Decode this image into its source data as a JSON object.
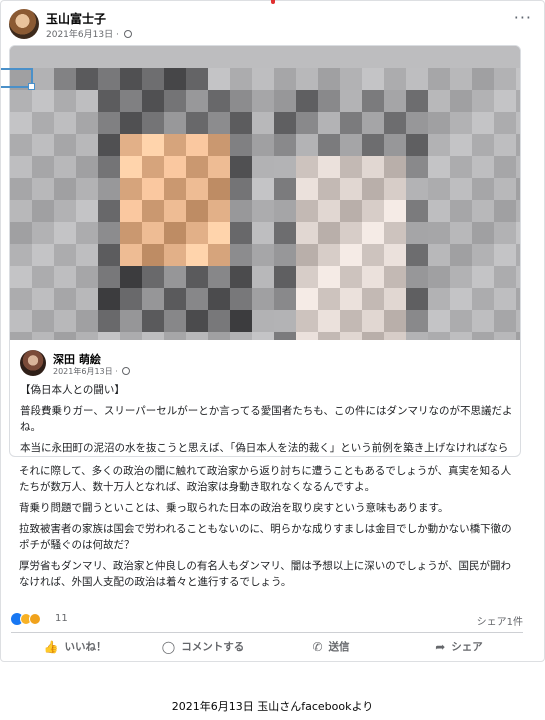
{
  "post": {
    "author": "玉山富士子",
    "date": "2021年6月13日",
    "separator": "·",
    "more_icon": "more-horizontal-icon",
    "privacy_icon": "globe-icon"
  },
  "shared_post": {
    "author": "深田 萌絵",
    "date": "2021年6月13日",
    "separator": "·",
    "privacy_icon": "globe-icon",
    "paragraphs": [
      "【偽日本人との闘い】",
      "普段費乗りガー、スリーパーセルがーとか言ってる愛国者たちも、この件にはダンマリなのが不思議だよね。",
      "本当に永田町の泥沼の水を抜こうと思えば、「偽日本人を法的裁く」という前例を築き上げなければならない。"
    ]
  },
  "post_text": {
    "paragraphs": [
      "それに際して、多くの政治の闇に触れて政治家から返り討ちに遭うこともあるでしょうが、真実を知る人たちが数万人、数十万人となれば、政治家は身動き取れなくなるんですよ。",
      "背乗り問題で闘うといことは、乗っ取られた日本の政治を取り戻すという意味もあります。",
      "拉致被害者の家族は国会で労われることもないのに、明らかな成りすましは金目でしか動かない橋下徹のポチが騒ぐのは何故だ？",
      "厚労省もダンマリ、政治家と仲良しの有名人もダンマリ、闇は予想以上に深いのでしょうが、国民が闘わなければ、外国人支配の政治は着々と進行するでしょう。"
    ]
  },
  "reactions": {
    "count": "11",
    "shares": "シェア1件",
    "icons": [
      "like-reaction-icon",
      "haha-reaction-icon",
      "sad-reaction-icon"
    ]
  },
  "actions": [
    {
      "label": "いいね！",
      "icon": "thumbs-up-icon"
    },
    {
      "label": "コメントする",
      "icon": "comment-icon"
    },
    {
      "label": "送信",
      "icon": "messenger-icon"
    },
    {
      "label": "シェア",
      "icon": "share-icon"
    }
  ],
  "caption": "2021年6月13日 玉山さんfacebookより"
}
